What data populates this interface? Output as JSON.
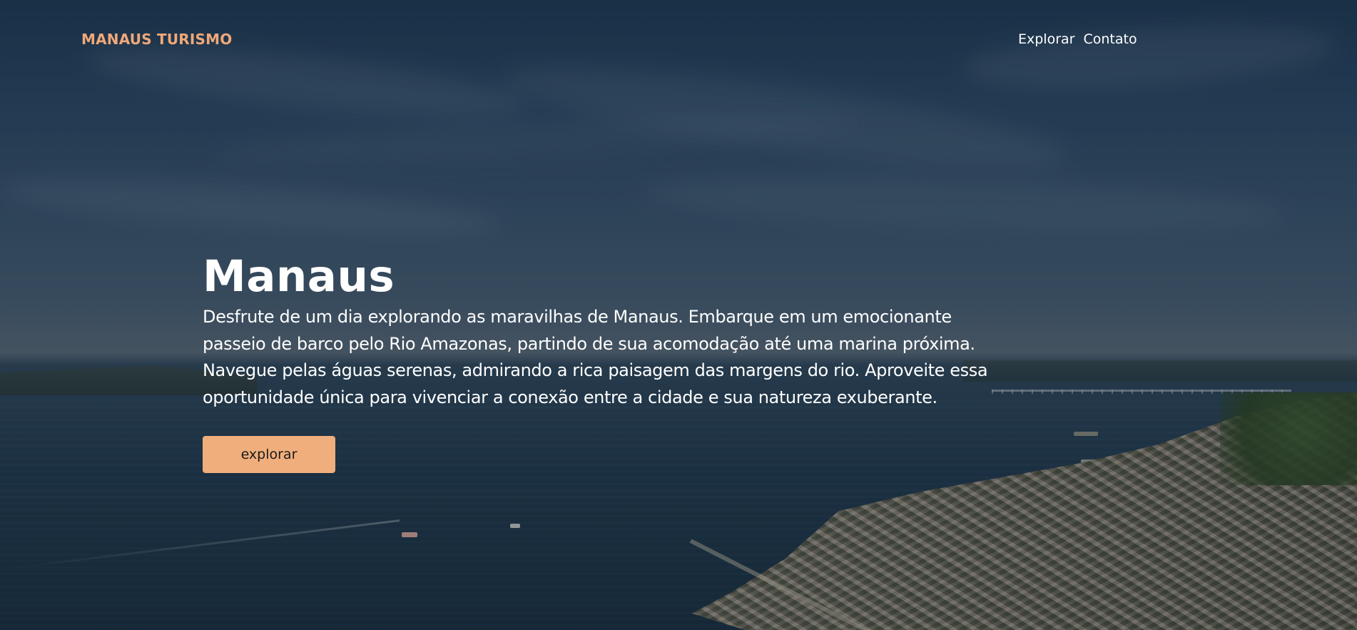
{
  "header": {
    "brand": "MANAUS TURISMO",
    "nav": [
      {
        "label": "Explorar"
      },
      {
        "label": "Contato"
      }
    ]
  },
  "hero": {
    "title": "Manaus",
    "description": "Desfrute de um dia explorando as maravilhas de Manaus. Embarque em um emocionante passeio de barco pelo Rio Amazonas, partindo de sua acomodação até uma marina próxima. Navegue pelas águas serenas, admirando a rica paisagem das margens do rio. Aproveite essa oportunidade única para vivenciar a conexão entre a cidade e sua natureza exuberante.",
    "button_label": "explorar"
  },
  "colors": {
    "accent": "#f0ae7c",
    "brand_text": "#f0a878",
    "text": "#ffffff"
  }
}
